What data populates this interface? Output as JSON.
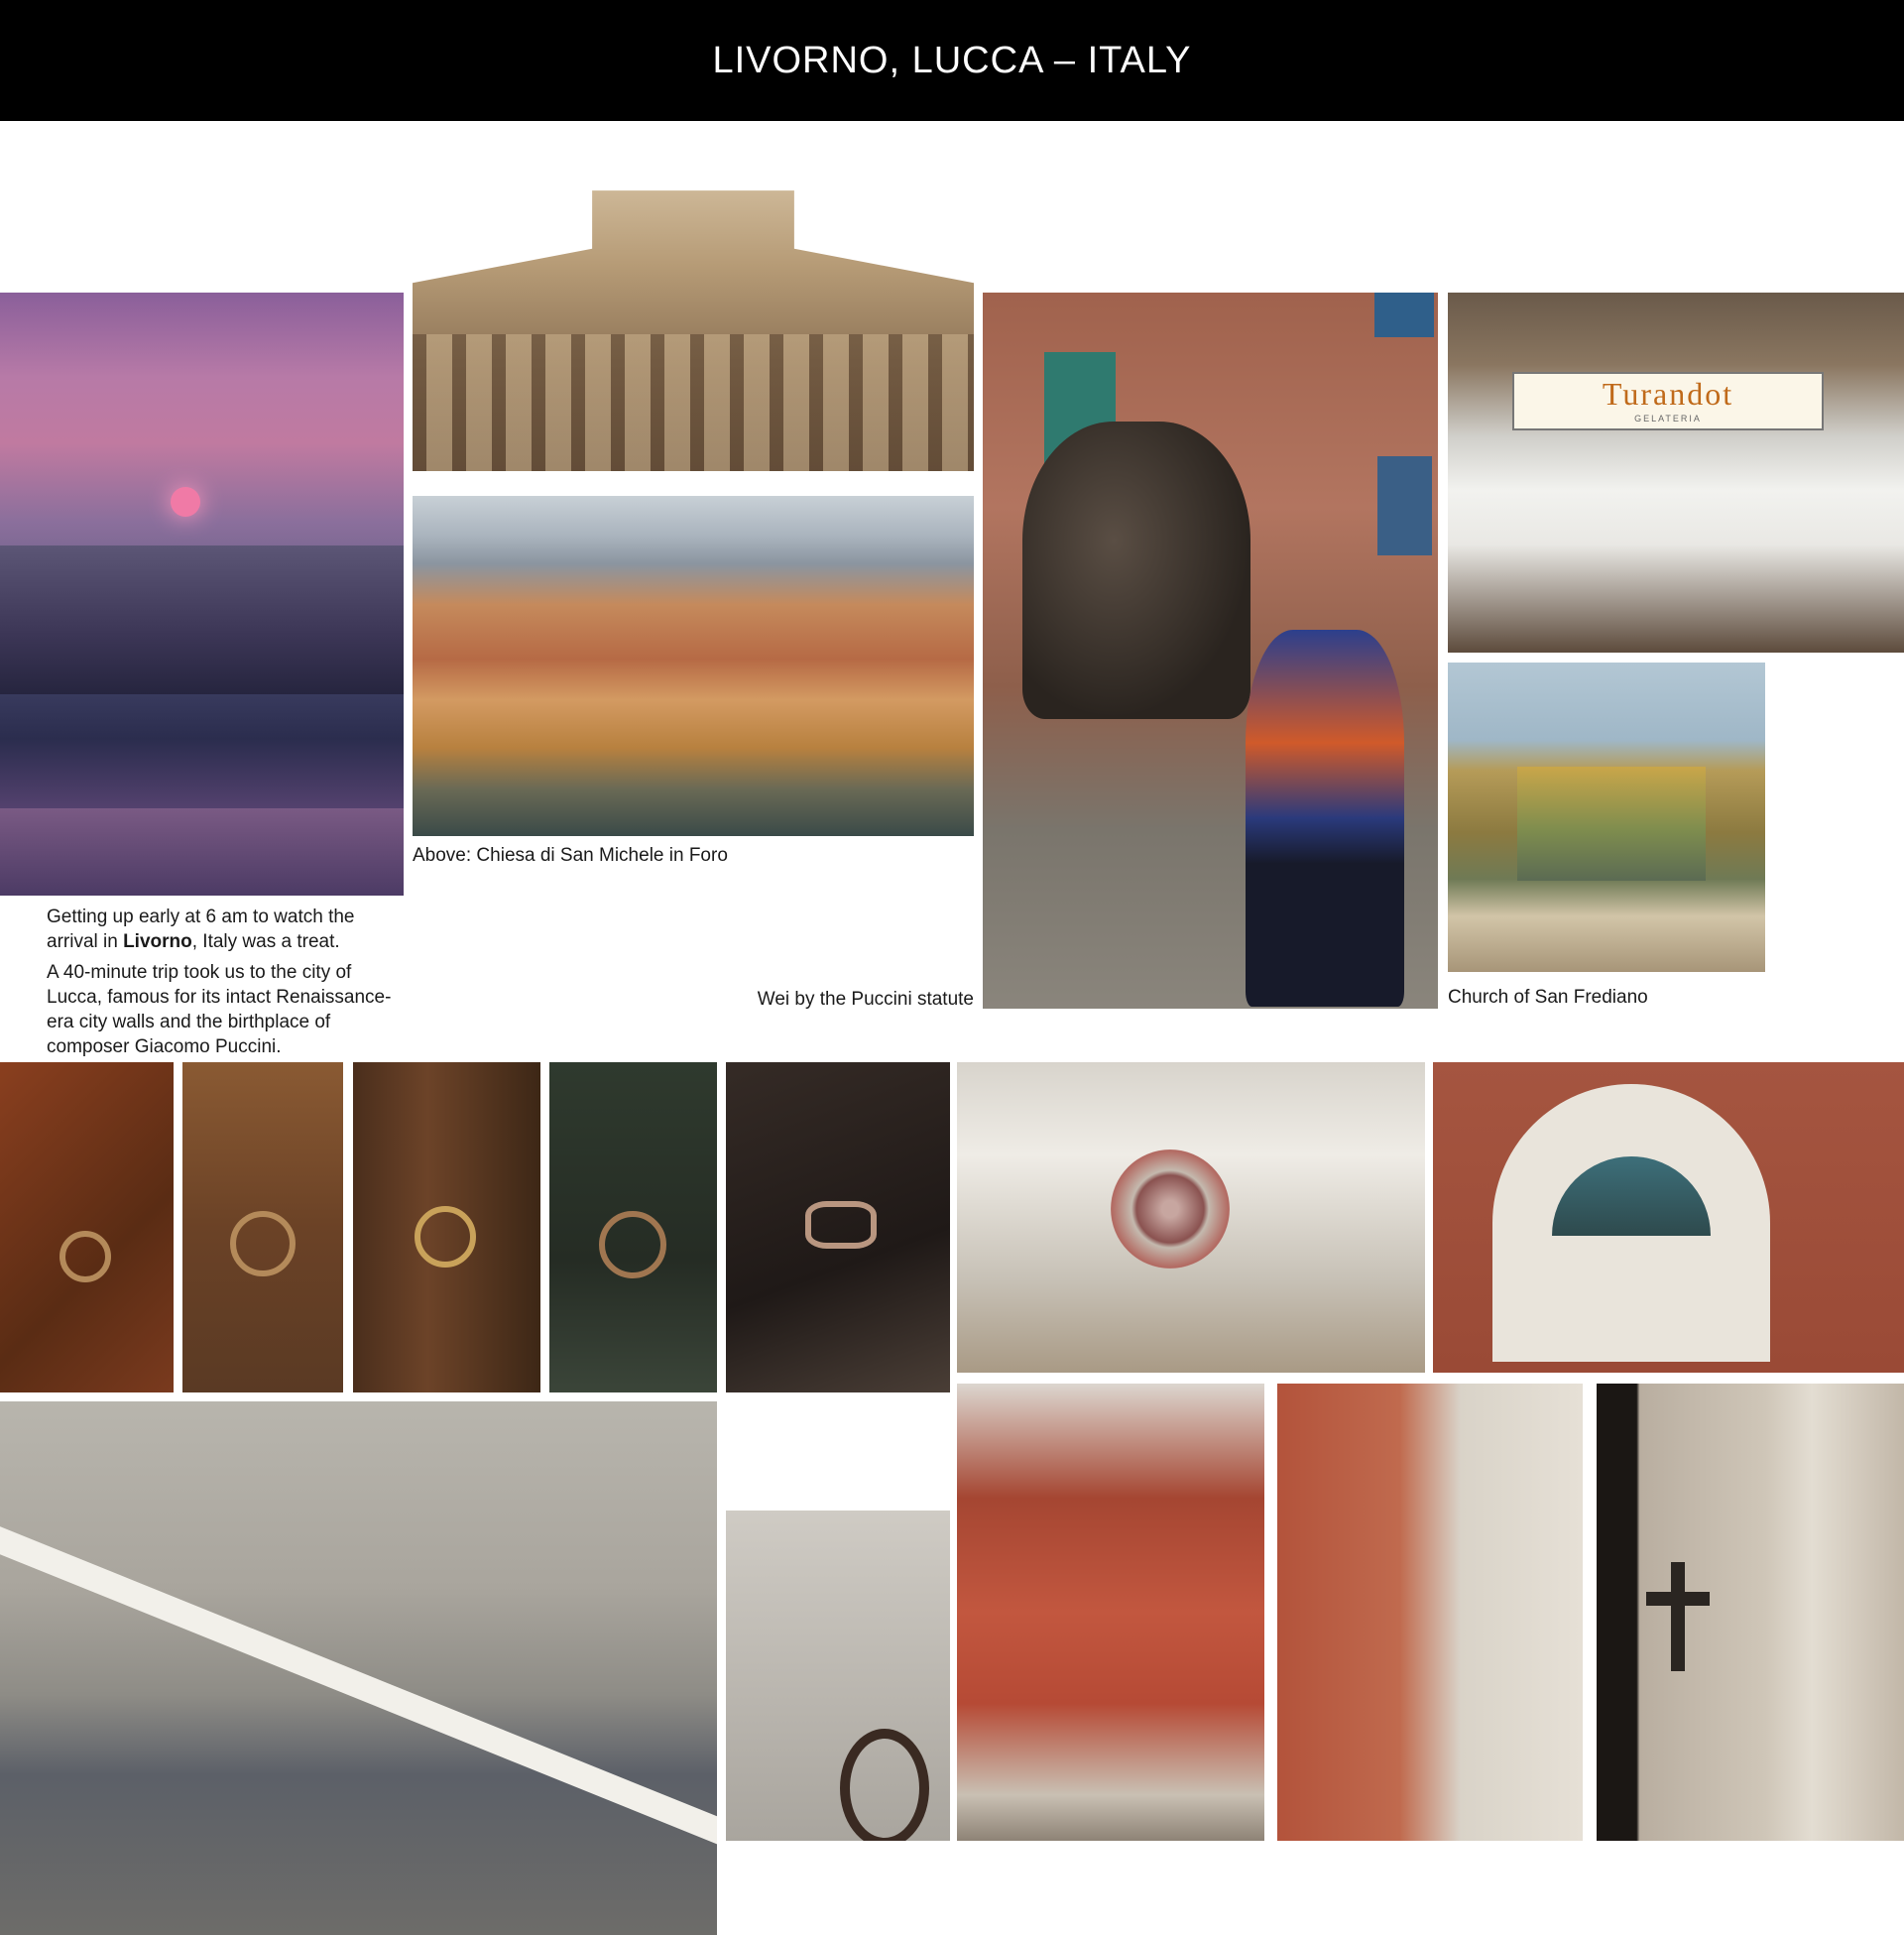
{
  "header": {
    "title": "LIVORNO, LUCCA – ITALY"
  },
  "captions": {
    "intro_p1_pre": "Getting up early at 6 am to watch the arrival in ",
    "intro_p1_bold": "Livorno",
    "intro_p1_post": ", Italy was a treat.",
    "intro_p2": "A 40-minute trip took us to the city of Lucca, famous for its intact Renaissance-era city walls and the birthplace of composer Giacomo Puccini.",
    "michele": "Above:  Chiesa di San Michele in Foro",
    "puccini": "Wei by the Puccini statute",
    "frediano": "Church of San Frediano"
  },
  "signs": {
    "turandot_main": "Turandot",
    "turandot_sub": "GELATERIA"
  }
}
